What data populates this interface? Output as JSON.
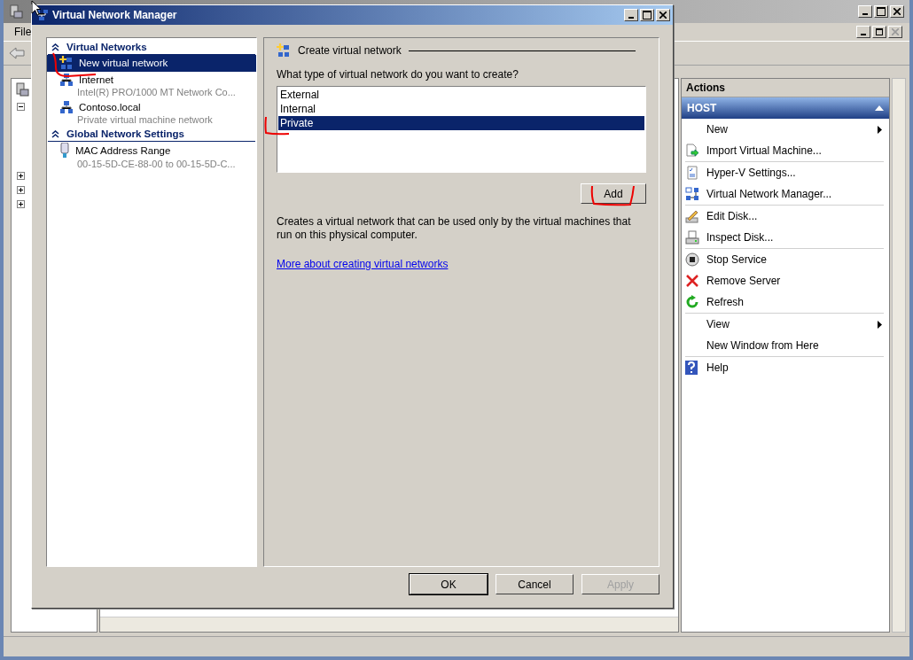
{
  "main_window": {
    "menu": [
      {
        "label": "File"
      }
    ],
    "tree_nodes": [
      {
        "expanded": true
      },
      {
        "expanded": false
      },
      {
        "expanded": false
      },
      {
        "expanded": false
      }
    ]
  },
  "actions": {
    "title": "Actions",
    "section": {
      "label": "HOST",
      "expanded": true
    },
    "groups": [
      [
        {
          "label": "New",
          "submenu": true
        },
        {
          "label": "Import Virtual Machine...",
          "submenu": false
        }
      ],
      [
        {
          "label": "Hyper-V Settings...",
          "submenu": false
        },
        {
          "label": "Virtual Network Manager...",
          "submenu": false
        }
      ],
      [
        {
          "label": "Edit Disk...",
          "submenu": false
        },
        {
          "label": "Inspect Disk...",
          "submenu": false
        }
      ],
      [
        {
          "label": "Stop Service",
          "submenu": false
        },
        {
          "label": "Remove Server",
          "submenu": false
        },
        {
          "label": "Refresh",
          "submenu": false
        }
      ],
      [
        {
          "label": "View",
          "submenu": true
        },
        {
          "label": "New Window from Here",
          "submenu": false
        }
      ],
      [
        {
          "label": "Help",
          "submenu": false
        }
      ]
    ]
  },
  "dialog": {
    "title": "Virtual Network Manager",
    "sections": [
      {
        "title": "Virtual Networks",
        "expanded": true,
        "items": [
          {
            "label": "New virtual network",
            "selected": true
          },
          {
            "label": "Internet",
            "detail": "Intel(R) PRO/1000 MT Network Co...",
            "selected": false
          },
          {
            "label": "Contoso.local",
            "detail": "Private virtual machine network",
            "selected": false
          }
        ]
      },
      {
        "title": "Global Network Settings",
        "expanded": true,
        "items": [
          {
            "label": "MAC Address Range",
            "detail": "00-15-5D-CE-88-00 to 00-15-5D-C...",
            "selected": false
          }
        ]
      }
    ],
    "panel": {
      "heading": "Create virtual network",
      "question": "What type of virtual network do you want to create?",
      "options": [
        {
          "label": "External",
          "selected": false
        },
        {
          "label": "Internal",
          "selected": false
        },
        {
          "label": "Private",
          "selected": true
        }
      ],
      "add_button": "Add",
      "description": "Creates a virtual network that can be used only by the virtual machines that run on this physical computer.",
      "link": "More about creating virtual networks"
    },
    "buttons": [
      {
        "label": "OK",
        "default": true,
        "disabled": false
      },
      {
        "label": "Cancel",
        "default": false,
        "disabled": false
      },
      {
        "label": "Apply",
        "default": false,
        "disabled": true
      }
    ]
  }
}
